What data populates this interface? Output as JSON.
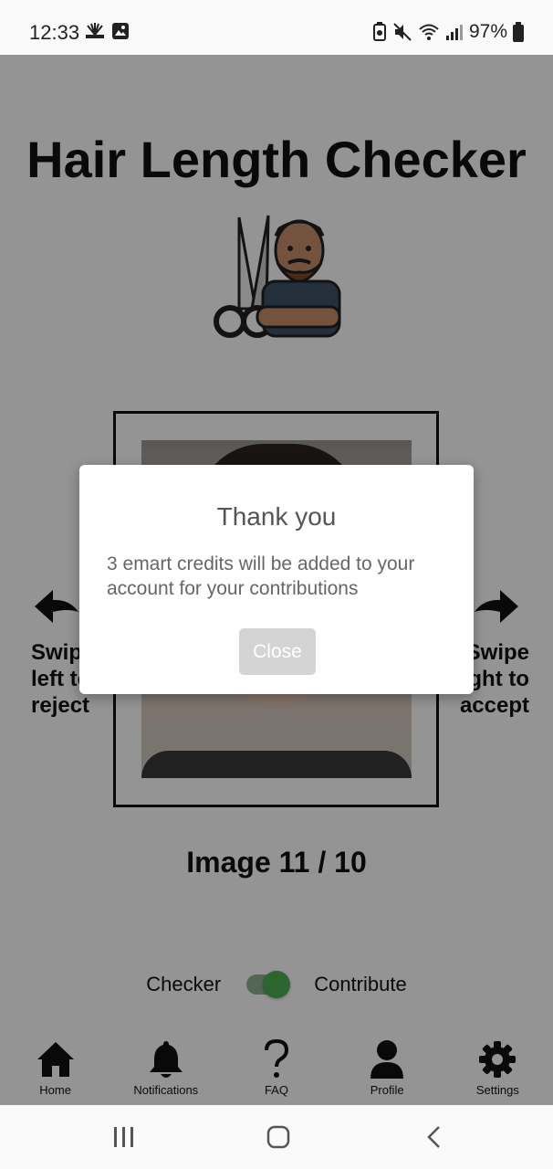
{
  "status_bar": {
    "time": "12:33",
    "battery_percent": "97%"
  },
  "app": {
    "title": "Hair Length Checker",
    "swipe_left": [
      "Swipe",
      "left to",
      "reject"
    ],
    "swipe_right": [
      "Swipe",
      "right to",
      "accept"
    ],
    "counter": "Image 11 / 10",
    "mode": {
      "left_label": "Checker",
      "right_label": "Contribute",
      "toggle_on": true
    }
  },
  "bottom_nav": {
    "items": [
      {
        "label": "Home",
        "icon": "home-icon"
      },
      {
        "label": "Notifications",
        "icon": "bell-icon"
      },
      {
        "label": "FAQ",
        "icon": "question-icon"
      },
      {
        "label": "Profile",
        "icon": "person-icon"
      },
      {
        "label": "Settings",
        "icon": "gear-icon"
      }
    ]
  },
  "dialog": {
    "title": "Thank you",
    "message": "3 emart credits will be added to your account for your contributions",
    "close_label": "Close"
  },
  "colors": {
    "toggle_on": "#4caf50",
    "overlay": "rgba(0,0,0,0.42)",
    "close_button": "#d4d4d4"
  }
}
